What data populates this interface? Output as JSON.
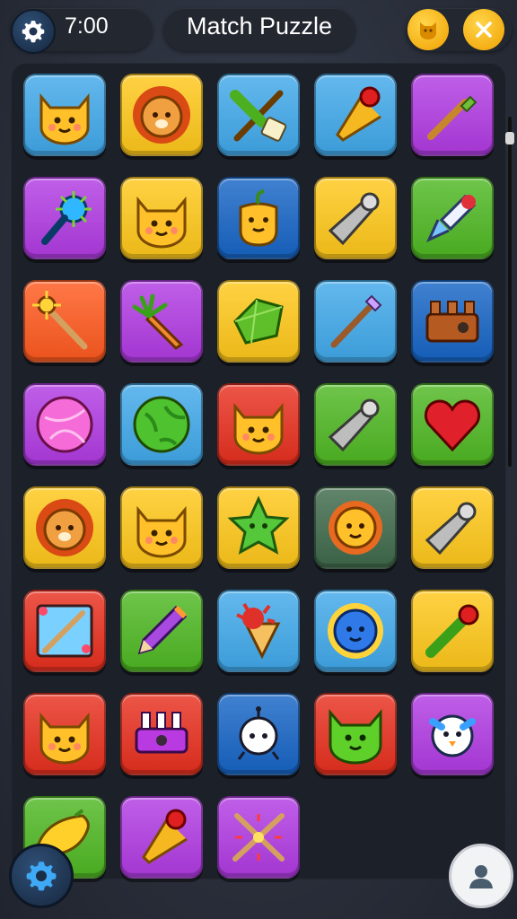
{
  "header": {
    "timer": "7:00",
    "title": "Match Puzzle"
  },
  "icons": {
    "settings_top": "gear-icon",
    "bonus": "cat-face-icon",
    "close": "close-icon",
    "settings_bottom": "gear-icon",
    "profile": "user-icon"
  },
  "colors": {
    "blue": "#41a9ea",
    "red": "#e8301f",
    "yellow": "#ffc81a",
    "purple": "#b13be3",
    "green": "#4fb823",
    "orange": "#ff5a1f",
    "navy": "#1765c6",
    "darkgreen": "#3f6a4b",
    "accent": "#f7b515"
  },
  "board": {
    "tiles": [
      {
        "bg": "blue",
        "icon": "cat"
      },
      {
        "bg": "yellow",
        "icon": "lion"
      },
      {
        "bg": "blue",
        "icon": "crossed-tools"
      },
      {
        "bg": "blue",
        "icon": "bowling-pin"
      },
      {
        "bg": "purple",
        "icon": "paintbrush"
      },
      {
        "bg": "purple",
        "icon": "spiky-mace"
      },
      {
        "bg": "yellow",
        "icon": "cat"
      },
      {
        "bg": "navy",
        "icon": "sprout-face"
      },
      {
        "bg": "yellow",
        "icon": "cone-pin"
      },
      {
        "bg": "green",
        "icon": "rocket"
      },
      {
        "bg": "orange",
        "icon": "wand"
      },
      {
        "bg": "purple",
        "icon": "carrot"
      },
      {
        "bg": "yellow",
        "icon": "green-gem"
      },
      {
        "bg": "blue",
        "icon": "brush"
      },
      {
        "bg": "navy",
        "icon": "machine"
      },
      {
        "bg": "purple",
        "icon": "pink-orb"
      },
      {
        "bg": "blue",
        "icon": "green-orb"
      },
      {
        "bg": "red",
        "icon": "cat"
      },
      {
        "bg": "green",
        "icon": "cone-pin"
      },
      {
        "bg": "green",
        "icon": "heart"
      },
      {
        "bg": "yellow",
        "icon": "lion"
      },
      {
        "bg": "yellow",
        "icon": "cat"
      },
      {
        "bg": "yellow",
        "icon": "star-face"
      },
      {
        "bg": "darkgreen",
        "icon": "sun-face"
      },
      {
        "bg": "yellow",
        "icon": "cone-pin"
      },
      {
        "bg": "red",
        "icon": "frame-tool"
      },
      {
        "bg": "green",
        "icon": "pencil"
      },
      {
        "bg": "blue",
        "icon": "splat-cone"
      },
      {
        "bg": "blue",
        "icon": "blue-sun"
      },
      {
        "bg": "yellow",
        "icon": "green-brush"
      },
      {
        "bg": "red",
        "icon": "cat"
      },
      {
        "bg": "red",
        "icon": "machine-purple"
      },
      {
        "bg": "navy",
        "icon": "ghost"
      },
      {
        "bg": "red",
        "icon": "green-cat"
      },
      {
        "bg": "purple",
        "icon": "bird"
      },
      {
        "bg": "green",
        "icon": "lemon"
      },
      {
        "bg": "purple",
        "icon": "bowling-pin"
      },
      {
        "bg": "purple",
        "icon": "crossed-sticks"
      }
    ]
  }
}
